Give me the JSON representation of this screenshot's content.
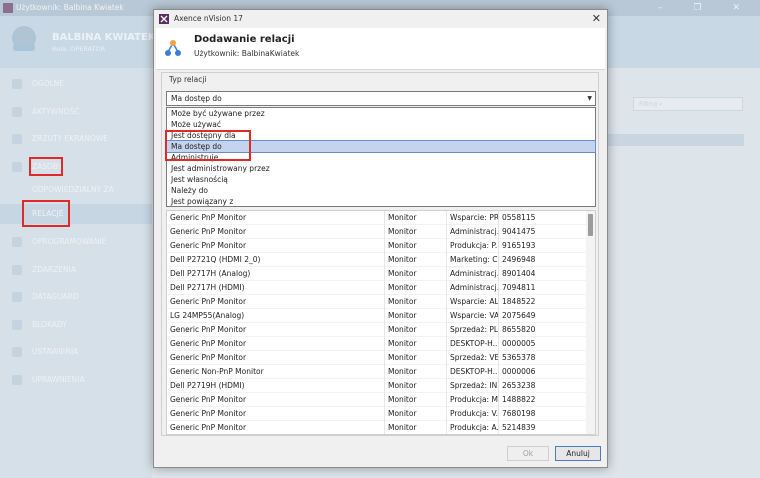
{
  "background": {
    "window_title": "Użytkownik: Balbina Kwiatek",
    "user_name": "BALBINA KWIATEK",
    "user_role": "Rola: OPERATOR",
    "filter_placeholder": "Filtruj",
    "nav": {
      "ogolne": "OGÓLNE",
      "aktywnosc": "AKTYWNOŚĆ",
      "zrzuty": "ZRZUTY EKRANOWE",
      "zasoby": "ZASOBY",
      "odpowiedzialny": "ODPOWIEDZIALNY ZA",
      "relacje": "RELACJE",
      "oprogramowanie": "OPROGRAMOWANIE",
      "zdarzenia": "ZDARZENIA",
      "dataguard": "DATAGUARD",
      "blokady": "BLOKADY",
      "ustawienia": "USTAWIENIA",
      "uprawnienia": "UPRAWNIENIA"
    }
  },
  "dialog": {
    "window_title": "Axence nVision 17",
    "title": "Dodawanie relacji",
    "subtitle": "Użytkownik: BalbinaKwiatek",
    "group_label": "Typ relacji",
    "selected_value": "Ma dostęp do",
    "options": [
      "Może być używane przez",
      "Może używać",
      "Jest dostępny dla",
      "Ma dostęp do",
      "Administruje",
      "Jest administrowany przez",
      "Jest własnością",
      "Należy do",
      "Jest powiązany z"
    ],
    "rows": [
      [
        "Generic PnP Monitor",
        "Monitor",
        "Wsparcie: PR...",
        "0558115"
      ],
      [
        "Generic PnP Monitor",
        "Monitor",
        "Administracj...",
        "9041475"
      ],
      [
        "Generic PnP Monitor",
        "Monitor",
        "Produkcja: P...",
        "9165193"
      ],
      [
        "Dell P2721Q (HDMI 2_0)",
        "Monitor",
        "Marketing: C...",
        "2496948"
      ],
      [
        "Dell P2717H (Analog)",
        "Monitor",
        "Administracj...",
        "8901404"
      ],
      [
        "Dell P2717H (HDMI)",
        "Monitor",
        "Administracj...",
        "7094811"
      ],
      [
        "Generic PnP Monitor",
        "Monitor",
        "Wsparcie: AL...",
        "1848522"
      ],
      [
        "LG 24MP55(Analog)",
        "Monitor",
        "Wsparcie: VA...",
        "2075649"
      ],
      [
        "Generic PnP Monitor",
        "Monitor",
        "Sprzedaż: PL...",
        "8655820"
      ],
      [
        "Generic PnP Monitor",
        "Monitor",
        "DESKTOP-H...",
        "0000005"
      ],
      [
        "Generic PnP Monitor",
        "Monitor",
        "Sprzedaż: VE...",
        "5365378"
      ],
      [
        "Generic Non-PnP Monitor",
        "Monitor",
        "DESKTOP-H...",
        "0000006"
      ],
      [
        "Dell P2719H (HDMI)",
        "Monitor",
        "Sprzedaż: IN...",
        "2653238"
      ],
      [
        "Generic PnP Monitor",
        "Monitor",
        "Produkcja: M...",
        "1488822"
      ],
      [
        "Generic PnP Monitor",
        "Monitor",
        "Produkcja: V...",
        "7680198"
      ],
      [
        "Generic PnP Monitor",
        "Monitor",
        "Produkcja: A...",
        "5214839"
      ]
    ],
    "ok_label": "Ok",
    "cancel_label": "Anuluj"
  },
  "colors": {
    "highlight_box": "#e02a2a",
    "selection": "#c4d3ee",
    "accent": "#4d7ac8"
  }
}
